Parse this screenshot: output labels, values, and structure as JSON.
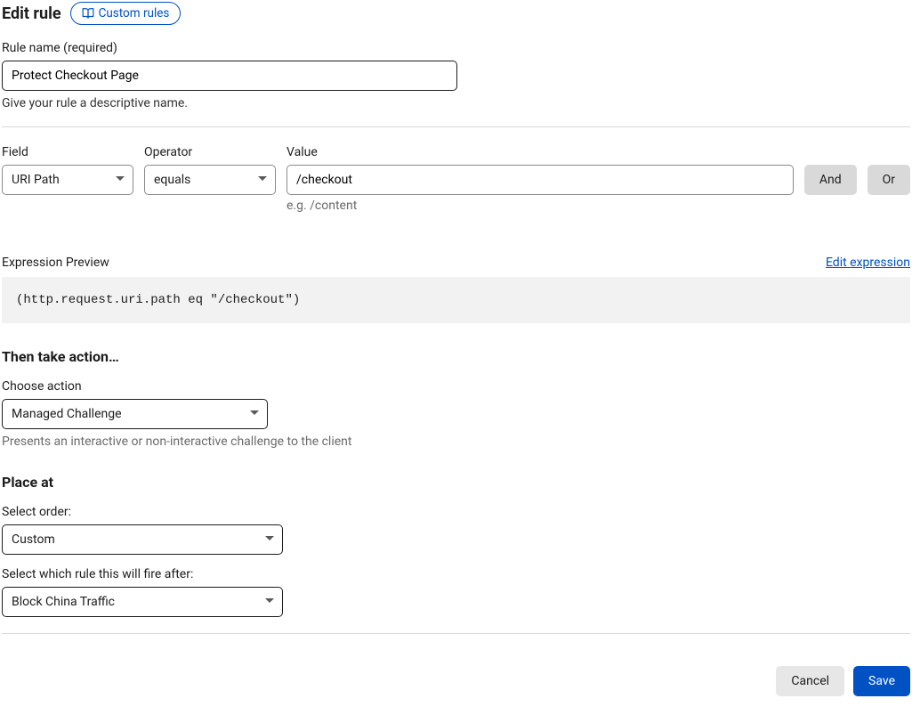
{
  "header": {
    "title": "Edit rule",
    "badge": "Custom rules"
  },
  "ruleName": {
    "label": "Rule name (required)",
    "value": "Protect Checkout Page",
    "helper": "Give your rule a descriptive name."
  },
  "condition": {
    "field": {
      "label": "Field",
      "value": "URI Path"
    },
    "operator": {
      "label": "Operator",
      "value": "equals"
    },
    "value": {
      "label": "Value",
      "value": "/checkout",
      "hint": "e.g. /content"
    },
    "and": "And",
    "or": "Or"
  },
  "preview": {
    "label": "Expression Preview",
    "editLink": "Edit expression",
    "expression": "(http.request.uri.path eq \"/checkout\")"
  },
  "action": {
    "title": "Then take action…",
    "chooseLabel": "Choose action",
    "value": "Managed Challenge",
    "helper": "Presents an interactive or non-interactive challenge to the client"
  },
  "placeAt": {
    "title": "Place at",
    "orderLabel": "Select order:",
    "orderValue": "Custom",
    "afterLabel": "Select which rule this will fire after:",
    "afterValue": "Block China Traffic"
  },
  "buttons": {
    "cancel": "Cancel",
    "save": "Save"
  }
}
